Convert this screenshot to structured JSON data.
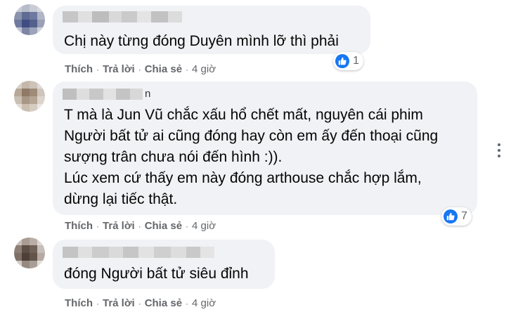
{
  "comments": [
    {
      "text": "Chị này từng đóng Duyên mình lỡ thì phải",
      "reaction_count": "1",
      "actions": {
        "like": "Thích",
        "reply": "Trả lời",
        "share": "Chia sẻ",
        "time": "4 giờ"
      }
    },
    {
      "author_suffix": "n",
      "text": "T mà là Jun Vũ chắc xấu hổ chết mất, nguyên cái phim\nNgười bất tử ai cũng đóng hay còn em ấy đến thoại cũng\nsượng trân chưa nói đến hình :)).\nLúc xem cứ thấy em này đóng arthouse chắc hợp lắm,\ndừng lại tiếc thật.",
      "reaction_count": "7",
      "actions": {
        "like": "Thích",
        "reply": "Trả lời",
        "share": "Chia sẻ",
        "time": "4 giờ"
      }
    },
    {
      "text": "đóng Người bất tử siêu đỉnh",
      "actions": {
        "like": "Thích",
        "reply": "Trả lời",
        "share": "Chia sẻ",
        "time": "4 giờ"
      }
    }
  ],
  "colors": {
    "bubble": "#f0f2f5",
    "text": "#050505",
    "meta": "#65676b",
    "like_blue": "#1877f2"
  },
  "icons": {
    "reaction": "like-thumbs-up-icon",
    "more": "more-options-icon"
  }
}
